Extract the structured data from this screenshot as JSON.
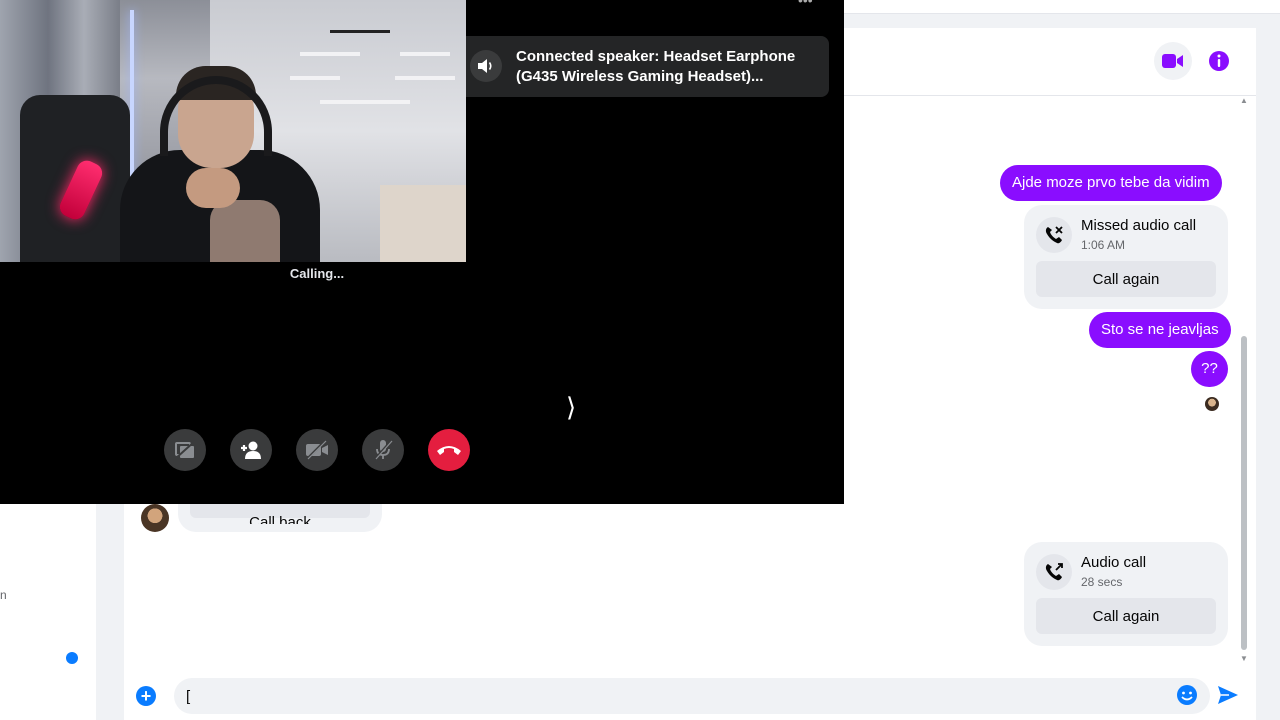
{
  "left_panel": {
    "text_fragment": "n",
    "unread_dot_color": "#0a7cff"
  },
  "header": {
    "video_icon": "video-camera-icon",
    "info_icon": "info-icon",
    "accent": "#8a0dff"
  },
  "messages": {
    "outgoing_1": "Ajde moze prvo tebe da vidim",
    "missed_call": {
      "title": "Missed audio call",
      "time": "1:06 AM",
      "button": "Call again",
      "icon": "missed-call-icon"
    },
    "outgoing_2": "Sto se ne jeavljas",
    "outgoing_3": "??",
    "peer_card_button": "Call back",
    "audio_call": {
      "title": "Audio call",
      "duration": "28 secs",
      "button": "Call again",
      "icon": "outgoing-call-icon"
    }
  },
  "composer": {
    "input_value": "[",
    "plus_icon": "plus-circle-icon",
    "emoji_icon": "emoji-icon",
    "send_icon": "send-icon"
  },
  "call": {
    "status": "Calling...",
    "toast": "Connected speaker: Headset Earphone (G435 Wireless Gaming Headset)...",
    "toast_icon": "speaker-icon",
    "controls": [
      "share-screen-off-icon",
      "add-person-icon",
      "video-off-icon",
      "mic-off-icon",
      "end-call-icon"
    ],
    "end_call_color": "#e41e3f"
  }
}
